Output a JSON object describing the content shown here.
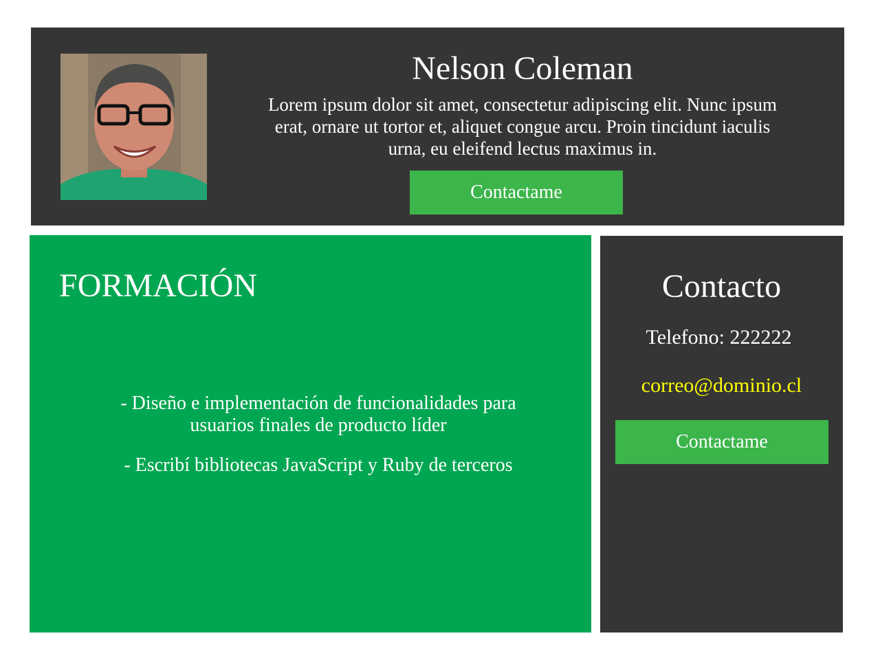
{
  "header": {
    "name": "Nelson Coleman",
    "bio": "Lorem ipsum dolor sit amet, consectetur adipiscing elit. Nunc ipsum erat, ornare ut tortor et, aliquet congue arcu. Proin tinci­dunt iaculis urna, eu eleifend lectus maximus in.",
    "button_label": "Contactame",
    "avatar_icon": "avatar-photo"
  },
  "formacion": {
    "title": "FORMACIÓN",
    "items": [
      "- Diseño e implementación de funcionalidades para usuarios finales de producto líder",
      "- Escribí bibliotecas JavaScript y Ruby de terceros"
    ]
  },
  "contacto": {
    "title": "Contacto",
    "telefono": "Telefono: 222222",
    "correo": "correo@dominio.cl",
    "button_label": "Contactame"
  },
  "colors": {
    "dark_panel": "#353535",
    "green_panel": "#00a651",
    "button_green": "#3cb54b",
    "email_yellow": "#ffff00",
    "text_white": "#ffffff"
  }
}
